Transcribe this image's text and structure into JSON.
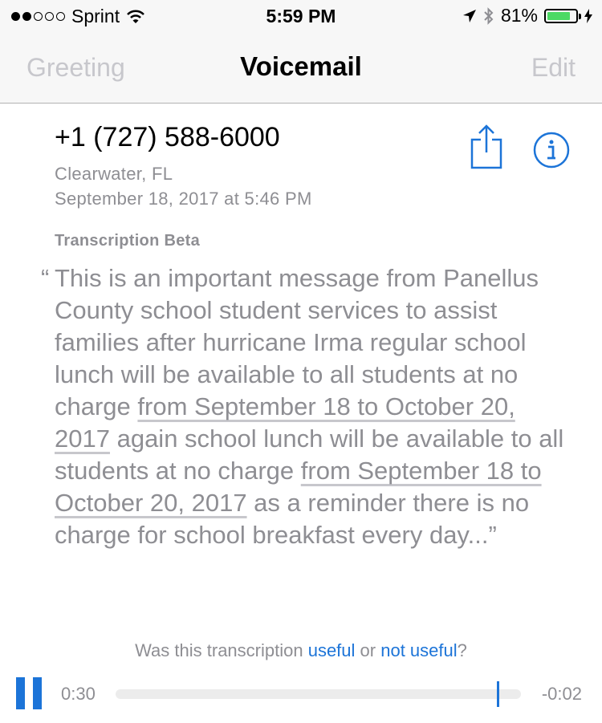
{
  "status_bar": {
    "carrier": "Sprint",
    "time": "5:59 PM",
    "battery": "81%",
    "battery_level": 0.81,
    "signal_bars": 2
  },
  "nav": {
    "left_label": "Greeting",
    "title": "Voicemail",
    "right_label": "Edit"
  },
  "voicemail": {
    "phone": "+1 (727) 588-6000",
    "location": "Clearwater, FL",
    "date": "September 18, 2017 at 5:46 PM",
    "transcription_label": "Transcription Beta",
    "open_quote": "“",
    "text_part1": "This is an important message from Panellus County school student services to assist families after hurricane Irma regular school lunch will be available to all students at no charge ",
    "underline1": "from September 18 to October 20, 2017",
    "text_part2": " again school lunch will be available to all students at no charge ",
    "underline2": "from September 18 to October 20, 2017",
    "text_part3": " as a reminder there is no charge for school breakfast every day...”"
  },
  "feedback": {
    "prefix": "Was this transcription ",
    "useful": "useful",
    "middle": " or ",
    "not_useful": "not useful",
    "suffix": "?"
  },
  "player": {
    "elapsed": "0:30",
    "remaining": "-0:02",
    "progress": 0.94
  },
  "colors": {
    "accent": "#1c74d8",
    "battery_fill": "#4cd964",
    "secondary_text": "#8e8e93"
  }
}
